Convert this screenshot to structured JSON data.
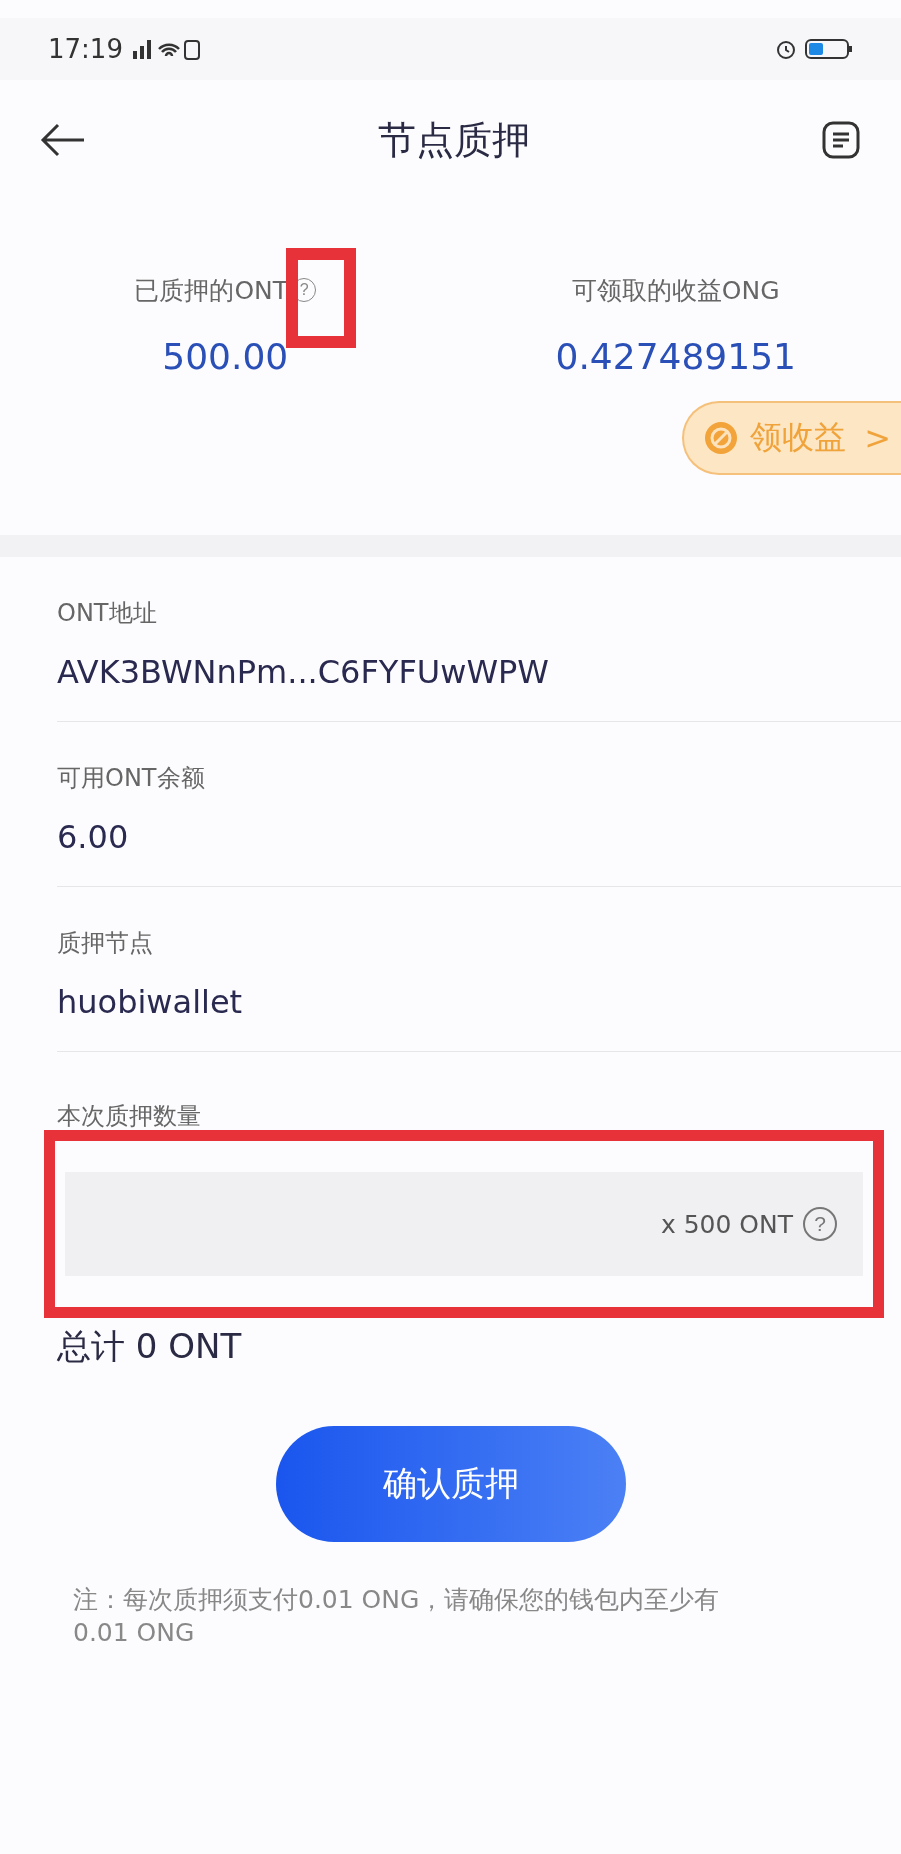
{
  "status_bar": {
    "time": "17:19"
  },
  "header": {
    "title": "节点质押"
  },
  "stats": [
    {
      "label": "已质押的ONT",
      "value": "500.00",
      "help_icon": "?",
      "highlighted": true
    },
    {
      "label": "可领取的收益ONG",
      "value": "0.427489151"
    }
  ],
  "claim_button": {
    "label": "领收益",
    "chevron": ">"
  },
  "fields": [
    {
      "label": "ONT地址",
      "value": "AVK3BWNnPm...C6FYFUwWPW"
    },
    {
      "label": "可用ONT余额",
      "value": "6.00"
    },
    {
      "label": "质押节点",
      "value": "huobiwallet"
    }
  ],
  "amount": {
    "label": "本次质押数量",
    "unit": "x 500 ONT",
    "help_icon": "?",
    "highlighted": true,
    "total": "总计 0 ONT"
  },
  "confirm_button": {
    "label": "确认质押"
  },
  "note": "注：每次质押须支付0.01 ONG，请确保您的钱包内至少有0.01 ONG"
}
